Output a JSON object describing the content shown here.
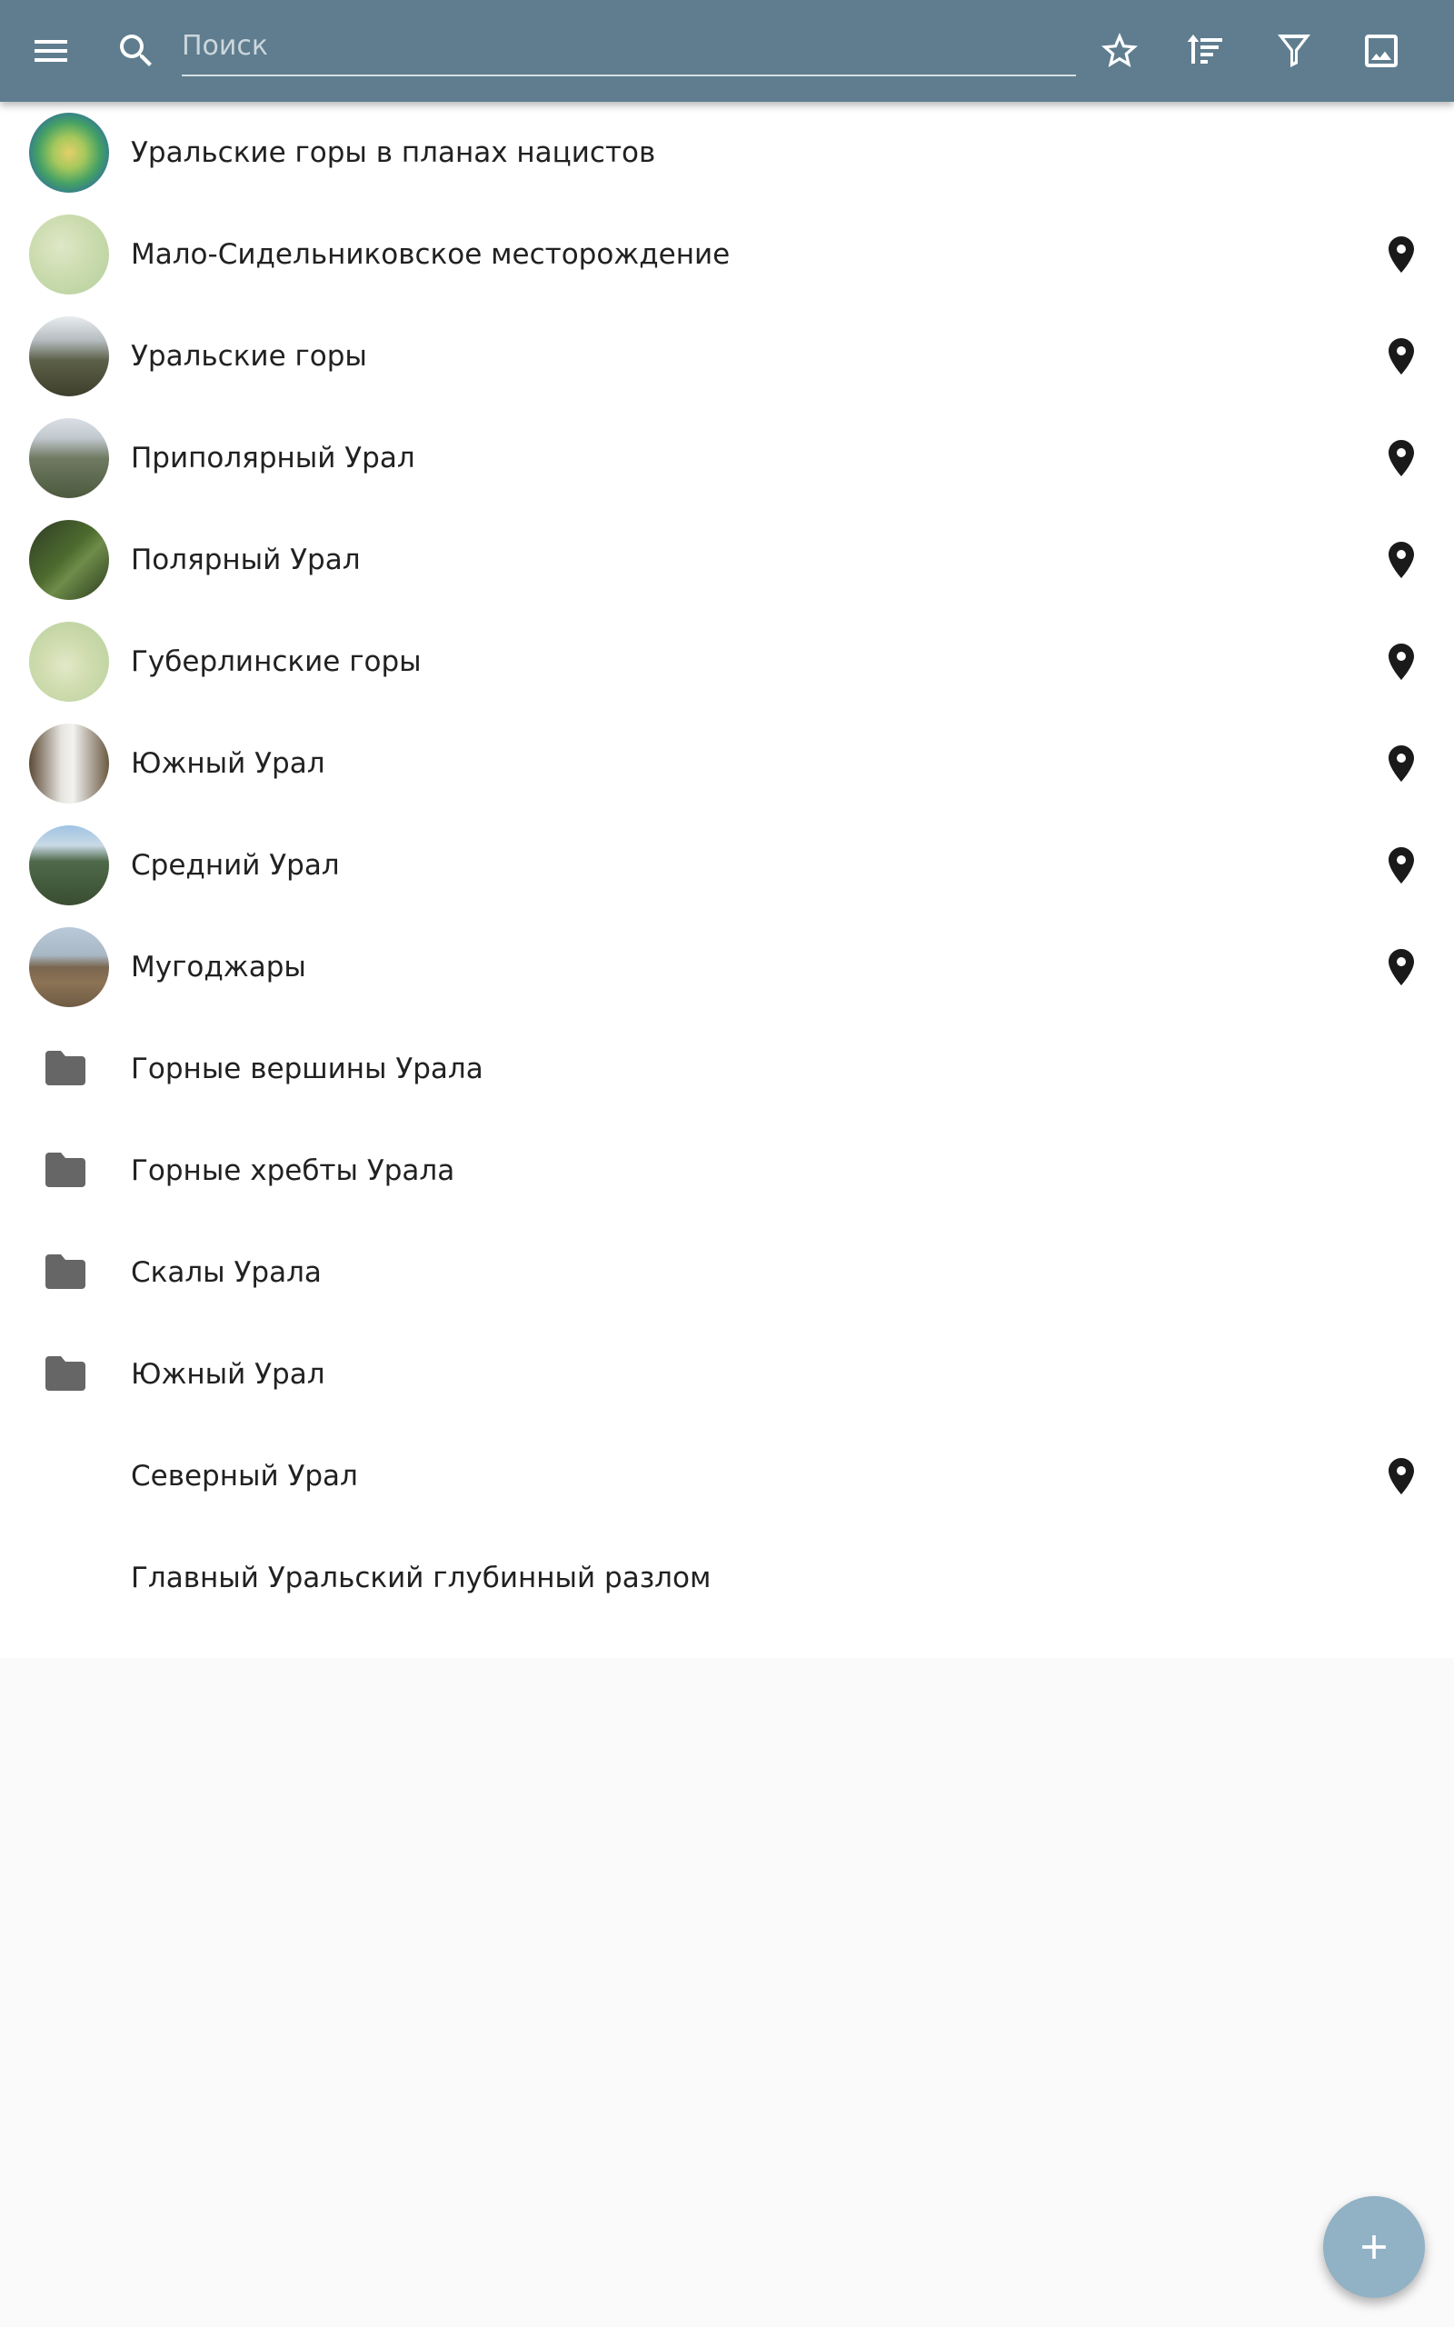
{
  "toolbar": {
    "background_color": "#5f7d8f",
    "icons": {
      "menu": "menu-icon",
      "search": "search-icon",
      "favorites": "star-outline-icon",
      "sort": "sort-icon",
      "filter": "filter-icon",
      "image": "image-icon"
    },
    "search": {
      "placeholder": "Поиск",
      "value": ""
    }
  },
  "list": {
    "items": [
      {
        "label": "Уральские горы в планах нацистов",
        "kind": "photo",
        "has_location": false
      },
      {
        "label": "Мало-Сидельниковское месторождение",
        "kind": "photo",
        "has_location": true
      },
      {
        "label": "Уральские горы",
        "kind": "photo",
        "has_location": true
      },
      {
        "label": "Приполярный Урал",
        "kind": "photo",
        "has_location": true
      },
      {
        "label": "Полярный Урал",
        "kind": "photo",
        "has_location": true
      },
      {
        "label": "Губерлинские горы",
        "kind": "photo",
        "has_location": true
      },
      {
        "label": "Южный Урал",
        "kind": "photo",
        "has_location": true
      },
      {
        "label": "Средний Урал",
        "kind": "photo",
        "has_location": true
      },
      {
        "label": "Мугоджары",
        "kind": "photo",
        "has_location": true
      },
      {
        "label": "Горные вершины Урала",
        "kind": "folder",
        "has_location": false
      },
      {
        "label": "Горные хребты Урала",
        "kind": "folder",
        "has_location": false
      },
      {
        "label": "Скалы Урала",
        "kind": "folder",
        "has_location": false
      },
      {
        "label": "Южный Урал",
        "kind": "folder",
        "has_location": false
      },
      {
        "label": "Северный Урал",
        "kind": "none",
        "has_location": true
      },
      {
        "label": "Главный Уральский глубинный разлом",
        "kind": "none",
        "has_location": false
      }
    ]
  },
  "fab": {
    "icon": "plus-icon",
    "color": "#91b1c5"
  }
}
